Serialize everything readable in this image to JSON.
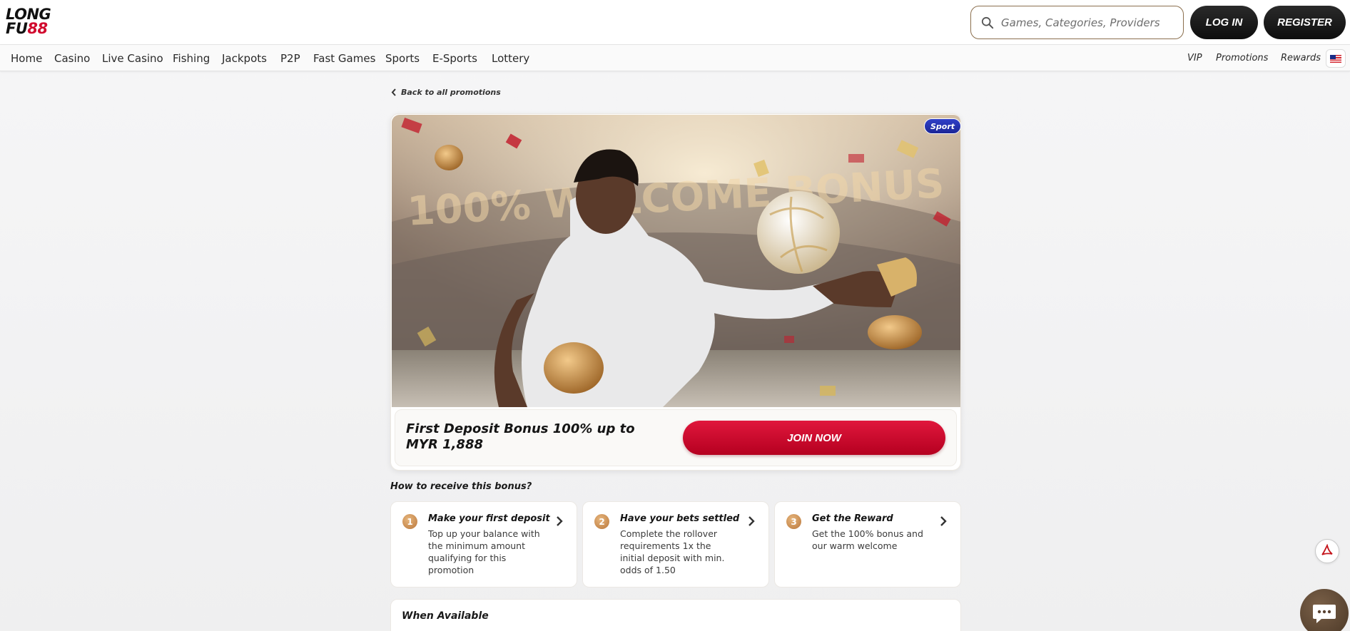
{
  "brand": {
    "logo_line1": "LONG",
    "logo_line2_a": "FU",
    "logo_line2_b": "88"
  },
  "search": {
    "placeholder": "Games, Categories, Providers"
  },
  "header": {
    "login_label": "LOG IN",
    "register_label": "REGISTER"
  },
  "nav": {
    "items": [
      "Home",
      "Casino",
      "Live Casino",
      "Fishing",
      "Jackpots",
      "P2P",
      "Fast Games",
      "Sports",
      "E-Sports",
      "Lottery"
    ],
    "right": [
      "VIP",
      "Promotions",
      "Rewards"
    ]
  },
  "back_link": "Back to all promotions",
  "banner": {
    "badge": "Sport",
    "headline_text": "100% WELCOME BONUS",
    "title": "First Deposit Bonus 100% up to MYR 1,888",
    "cta": "JOIN NOW"
  },
  "how_to": {
    "title": "How to receive this bonus?",
    "steps": [
      {
        "num": "1",
        "title": "Make your first deposit",
        "desc": "Top up your balance with the minimum amount qualifying for this promotion"
      },
      {
        "num": "2",
        "title": "Have your bets settled",
        "desc": "Complete the rollover requirements 1x the initial deposit with min. odds of 1.50"
      },
      {
        "num": "3",
        "title": "Get the Reward",
        "desc": "Get the 100% bonus and our warm welcome"
      }
    ]
  },
  "availability": {
    "title": "When Available"
  },
  "colors": {
    "accent_red": "#d10a2e",
    "badge_blue": "#2233b0",
    "dark_button": "#1a1a1a"
  },
  "icons": {
    "search": "search-icon",
    "back": "chevron-left-icon",
    "step_chevron": "chevron-right-icon",
    "pdf": "pdf-icon",
    "chat": "chat-icon",
    "flag": "malaysia-flag-icon"
  }
}
